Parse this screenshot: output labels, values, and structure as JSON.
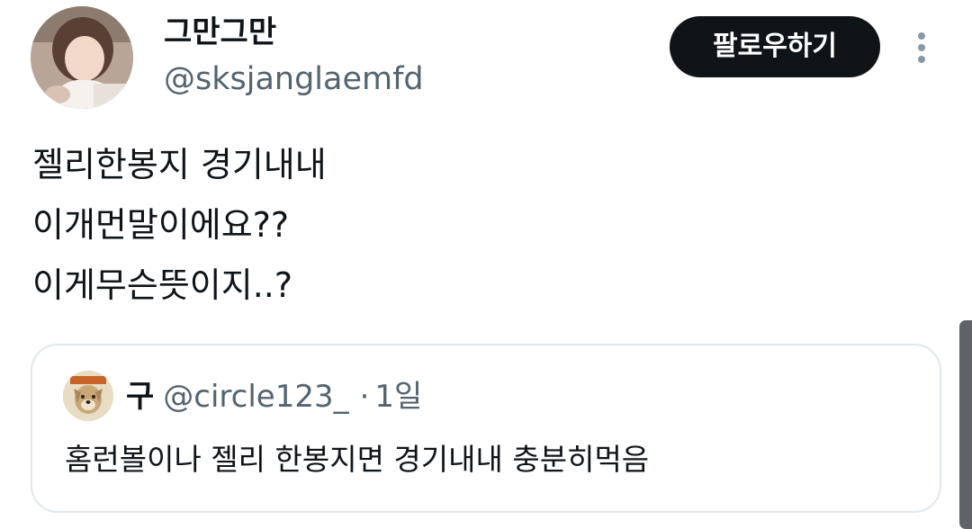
{
  "author": {
    "display_name": "그만그만",
    "handle": "@sksjanglaemfd"
  },
  "follow_button": {
    "label": "팔로우하기"
  },
  "tweet": {
    "lines": [
      "젤리한봉지 경기내내",
      "이개먼말이에요??",
      "이게무슨뜻이지..?"
    ]
  },
  "quoted_tweet": {
    "display_name": "구",
    "handle": "@circle123_",
    "separator": "·",
    "time": "1일",
    "text": "홈런볼이나 젤리 한봉지면 경기내내 충분히먹음"
  },
  "icons": {
    "more": "more-vertical-icon"
  }
}
